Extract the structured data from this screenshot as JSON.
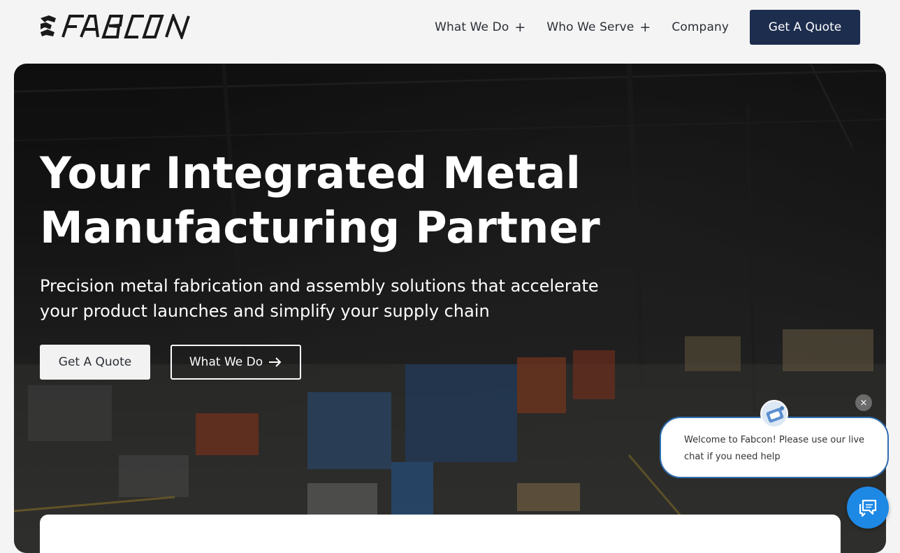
{
  "brand": {
    "logo_text": "FABCON"
  },
  "nav": {
    "items": [
      {
        "label": "What We Do",
        "has_submenu": true
      },
      {
        "label": "Who We Serve",
        "has_submenu": true
      },
      {
        "label": "Company",
        "has_submenu": false
      }
    ],
    "submenu_glyph": "+",
    "cta_label": "Get A Quote"
  },
  "hero": {
    "title_line1": "Your Integrated Metal",
    "title_line2": "Manufacturing Partner",
    "subtitle_line1": "Precision metal fabrication and assembly solutions that accelerate",
    "subtitle_line2": "your product launches and simplify your supply chain",
    "primary_button": "Get A Quote",
    "secondary_button": "What We Do"
  },
  "chat": {
    "close_glyph": "×",
    "message_line1": "Welcome to Fabcon! Please use our live",
    "message_line2": "chat if you need help",
    "launcher_icon": "chat-icon"
  },
  "colors": {
    "nav_cta_bg": "#1d2d4e",
    "chat_accent": "#1e88e5",
    "page_bg": "#f4f4f4"
  }
}
